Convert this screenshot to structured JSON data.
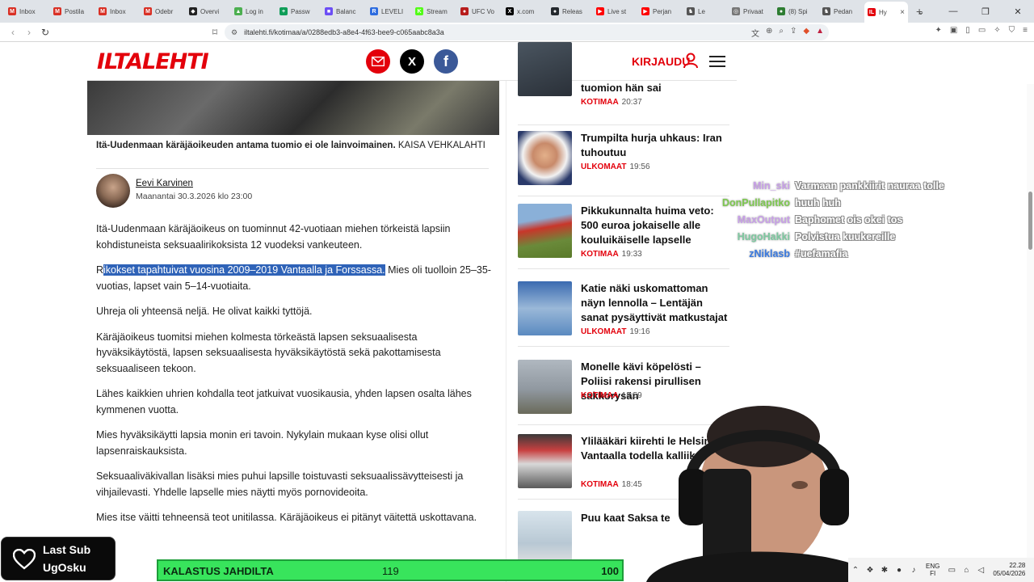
{
  "browser": {
    "tabs": [
      {
        "label": "Inbox",
        "icon": "gmail-icon",
        "color": "#d93025",
        "glyph": "M"
      },
      {
        "label": "Postila",
        "icon": "gmail-icon",
        "color": "#d93025",
        "glyph": "M"
      },
      {
        "label": "Inbox",
        "icon": "gmail-icon",
        "color": "#d93025",
        "glyph": "M"
      },
      {
        "label": "Odebr",
        "icon": "gmail-icon",
        "color": "#d93025",
        "glyph": "M"
      },
      {
        "label": "Overvi",
        "icon": "app-icon",
        "color": "#222222",
        "glyph": "◆"
      },
      {
        "label": "Log in",
        "icon": "app-icon",
        "color": "#4caf50",
        "glyph": "▲"
      },
      {
        "label": "Passw",
        "icon": "app-icon",
        "color": "#0f9d58",
        "glyph": "+"
      },
      {
        "label": "Balanc",
        "icon": "app-icon",
        "color": "#6c4ef5",
        "glyph": "■"
      },
      {
        "label": "LEVELI",
        "icon": "app-icon",
        "color": "#2d6cdf",
        "glyph": "R"
      },
      {
        "label": "Stream",
        "icon": "app-icon",
        "color": "#53fc18",
        "glyph": "K"
      },
      {
        "label": "UFC Vo",
        "icon": "app-icon",
        "color": "#b71c1c",
        "glyph": "●"
      },
      {
        "label": "x.com",
        "icon": "x-icon",
        "color": "#000000",
        "glyph": "X"
      },
      {
        "label": "Releas",
        "icon": "github-icon",
        "color": "#24292e",
        "glyph": "●"
      },
      {
        "label": "Live st",
        "icon": "youtube-icon",
        "color": "#ff0000",
        "glyph": "▶"
      },
      {
        "label": "Perjan",
        "icon": "youtube-icon",
        "color": "#ff0000",
        "glyph": "▶"
      },
      {
        "label": "Le",
        "icon": "app-icon",
        "color": "#555555",
        "glyph": "♞"
      },
      {
        "label": "Privaat",
        "icon": "app-icon",
        "color": "#777777",
        "glyph": "◎"
      },
      {
        "label": "(8) Spi",
        "icon": "app-icon",
        "color": "#2e7d32",
        "glyph": "●"
      },
      {
        "label": "Pedan",
        "icon": "app-icon",
        "color": "#555555",
        "glyph": "♞"
      },
      {
        "label": "Hy",
        "icon": "iltalehti-icon",
        "color": "#e3000b",
        "glyph": "IL",
        "active": true
      }
    ],
    "new_tab": "+",
    "url": "iltalehti.fi/kotimaa/a/0288edb3-a8e4-4f63-bee9-c065aabc8a3a"
  },
  "site": {
    "logo": "ILTALEHTI",
    "login": "KIRJAUDU",
    "social_x": "X",
    "social_fb": "f"
  },
  "article": {
    "caption_bold": "Itä-Uudenmaan käräjäoikeuden antama tuomio ei ole lainvoimainen.",
    "caption_credit": "KAISA VEHKALAHTI",
    "author": "Eevi Karvinen",
    "date": "Maanantai 30.3.2026 klo 23:00",
    "p1": "Itä-Uudenmaan käräjäoikeus on tuominnut 42-vuotiaan miehen törkeistä lapsiin kohdistuneista seksuaalirikoksista 12 vuodeksi vankeuteen.",
    "p2_pre": "R",
    "p2_sel": "ikokset tapahtuivat vuosina 2009–2019 Vantaalla ja Forssassa.",
    "p2_post": " Mies oli tuolloin 25–35-vuotias, lapset vain 5–14-vuotiaita.",
    "p3": "Uhreja oli yhteensä neljä. He olivat kaikki tyttöjä.",
    "p4": "Käräjäoikeus tuomitsi miehen kolmesta törkeästä lapsen seksuaalisesta hyväksikäytöstä, lapsen seksuaalisesta hyväksikäytöstä sekä pakottamisesta seksuaaliseen tekoon.",
    "p5": "Lähes kaikkien uhrien kohdalla teot jatkuivat vuosikausia, yhden lapsen osalta lähes kymmenen vuotta.",
    "p6": "Mies hyväksikäytti lapsia monin eri tavoin. Nykylain mukaan kyse olisi ollut lapsenraiskauksista.",
    "p7": "Seksuaaliväkivallan lisäksi mies puhui lapsille toistuvasti seksuaalissävytteisesti ja vihjailevasti. Yhdelle lapselle mies näytti myös pornovideoita.",
    "p8": "Mies itse väitti tehneensä teot unitilassa. Käräjäoikeus ei pitänyt väitettä uskottavana."
  },
  "sidebar": [
    {
      "title": "tuomion hän sai",
      "category": "KOTIMAA",
      "time": "20:37"
    },
    {
      "title": "Trumpilta hurja uhkaus: Iran tuhoutuu",
      "category": "ULKOMAAT",
      "time": "19:56"
    },
    {
      "title": "Pikkukunnalta huima veto: 500 euroa jokaiselle alle kouluikäiselle lapselle",
      "category": "KOTIMAA",
      "time": "19:33"
    },
    {
      "title": "Katie näki uskomattoman näyn lennolla – Lentäjän sanat pysäyttivät matkustajat",
      "category": "ULKOMAAT",
      "time": "19:16"
    },
    {
      "title": "Monelle kävi köpelösti – Poliisi rakensi pirullisen sakkorysän",
      "category": "KOTIMAA",
      "time": "18:59"
    },
    {
      "title": "Ylilääkäri kiirehti le Helsinki-Vantaalla todella kalliiksi",
      "category": "KOTIMAA",
      "time": "18:45"
    },
    {
      "title": "Puu kaat Saksa te",
      "category": "",
      "time": ""
    }
  ],
  "chat": [
    {
      "nick": "Min_ski",
      "color": "#c8a0e8",
      "message": "Varmaan pankkiirit nauraa tolle"
    },
    {
      "nick": "DonPullapitko",
      "color": "#7ec850",
      "message": "huuh huh"
    },
    {
      "nick": "MaxOutput",
      "color": "#c8a0e8",
      "message": "Baphomet ois okei tos"
    },
    {
      "nick": "HugoHakki",
      "color": "#7ec8a0",
      "message": "Polvistua kuukereille"
    },
    {
      "nick": "zNiklasb",
      "color": "#3a7ae0",
      "message": "#uefamafia"
    }
  ],
  "overlay": {
    "last_sub_label": "Last Sub",
    "last_sub_name": "UgOsku",
    "goal_label": "KALASTUS JAHDILTA",
    "goal_current": "119",
    "goal_target": "100"
  },
  "taskbar": {
    "lang_top": "ENG",
    "lang_bottom": "FI",
    "time": "22.28",
    "date": "05/04/2026"
  }
}
